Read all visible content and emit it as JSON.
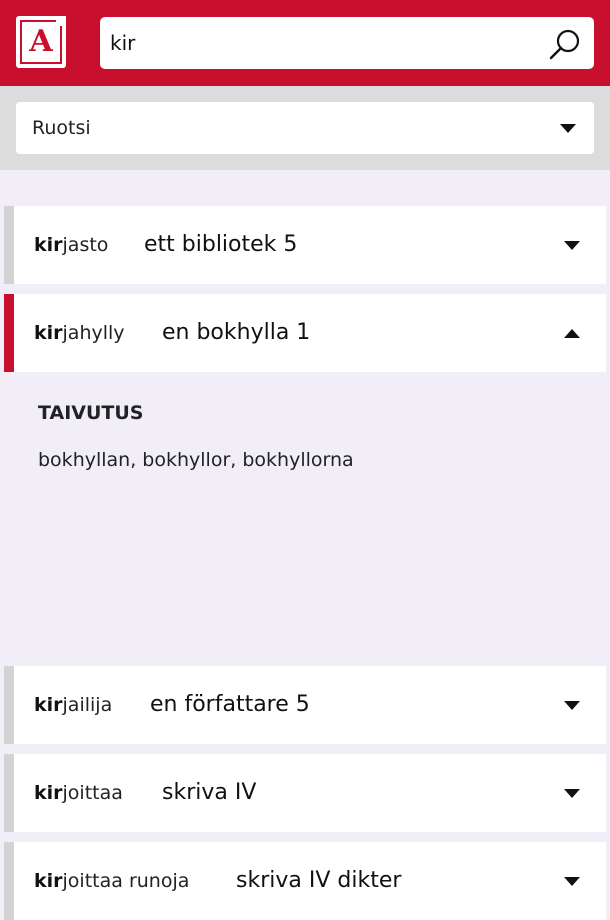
{
  "header": {
    "logo_letter": "A",
    "search_value": "kir",
    "search_icon": "search-icon"
  },
  "language_select": {
    "value": "Ruotsi"
  },
  "results": [
    {
      "match": "kir",
      "rest": "jasto",
      "translation": "ett bibliotek 5",
      "expanded": false
    },
    {
      "match": "kir",
      "rest": "jahylly",
      "translation": "en bokhylla 1",
      "expanded": true
    },
    {
      "match": "kir",
      "rest": "jailija",
      "translation": "en författare 5",
      "expanded": false
    },
    {
      "match": "kir",
      "rest": "joittaa",
      "translation": "skriva IV",
      "expanded": false
    },
    {
      "match": "kir",
      "rest": "joittaa runoja",
      "translation": "skriva IV dikter",
      "expanded": false
    }
  ],
  "expanded_panel": {
    "heading": "TAIVUTUS",
    "text": "bokhyllan, bokhyllor, bokhyllorna"
  },
  "colors": {
    "brand_red": "#c8102e",
    "panel_bg": "#f1eef7",
    "row_border": "#d3d3d3"
  }
}
